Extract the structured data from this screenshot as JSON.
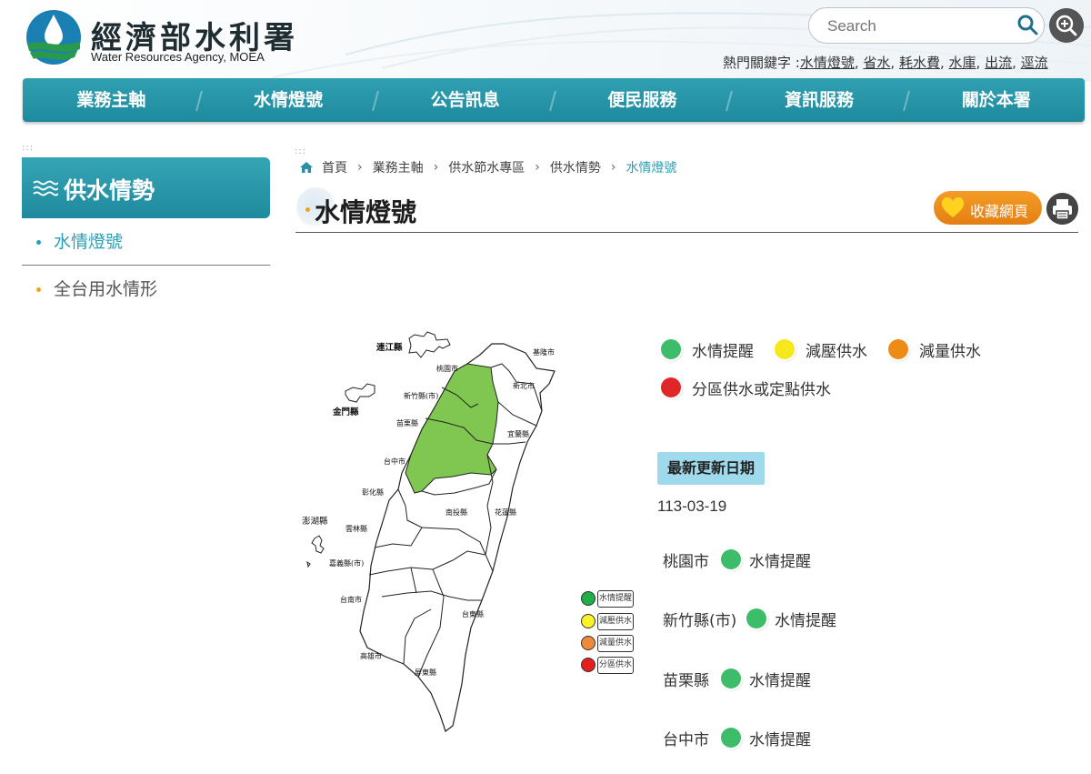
{
  "header": {
    "brand_cn": "經濟部水利署",
    "brand_en": "Water Resources Agency, MOEA",
    "search_placeholder": "Search",
    "hot_keys_label": "熱門關鍵字 :",
    "hot_keys": [
      "水情燈號",
      "省水",
      "耗水費",
      "水庫",
      "出流",
      "逕流"
    ]
  },
  "nav": {
    "items": [
      "業務主軸",
      "水情燈號",
      "公告訊息",
      "便民服務",
      "資訊服務",
      "關於本署"
    ]
  },
  "sidebar": {
    "title": "供水情勢",
    "items": [
      {
        "label": "水情燈號",
        "active": true
      },
      {
        "label": "全台用水情形",
        "active": false
      }
    ]
  },
  "breadcrumb": [
    "首頁",
    "業務主軸",
    "供水節水專區",
    "供水情勢",
    "水情燈號"
  ],
  "page_title": "水情燈號",
  "favorite_label": "收藏網頁",
  "colors": {
    "teal": "#2a9fb3",
    "green": "#3dbd6a",
    "yellow": "#f7e81c",
    "orange": "#ec8b16",
    "red": "#e02626",
    "map_green": "#7fc750"
  },
  "legend": [
    {
      "label": "水情提醒",
      "color": "#3dbd6a"
    },
    {
      "label": "減壓供水",
      "color": "#f7e81c"
    },
    {
      "label": "減量供水",
      "color": "#ec8b16"
    },
    {
      "label": "分區供水或定點供水",
      "color": "#e02626"
    }
  ],
  "map": {
    "labels": [
      "連江縣",
      "金門縣",
      "澎湖縣",
      "基隆市",
      "新北市",
      "桃園市",
      "新竹縣(市)",
      "苗栗縣",
      "宜蘭縣",
      "台中市",
      "彰化縣",
      "南投縣",
      "花蓮縣",
      "雲林縣",
      "嘉義縣(市)",
      "台南市",
      "台東縣",
      "高雄市",
      "屏東縣"
    ],
    "legend": [
      "水情提醒",
      "減壓供水",
      "減量供水",
      "分區供水"
    ]
  },
  "update": {
    "label": "最新更新日期",
    "date": "113-03-19"
  },
  "status": [
    {
      "region": "桃園市",
      "status": "水情提醒"
    },
    {
      "region": "新竹縣(市)",
      "status": "水情提醒"
    },
    {
      "region": "苗栗縣",
      "status": "水情提醒"
    },
    {
      "region": "台中市",
      "status": "水情提醒"
    }
  ]
}
